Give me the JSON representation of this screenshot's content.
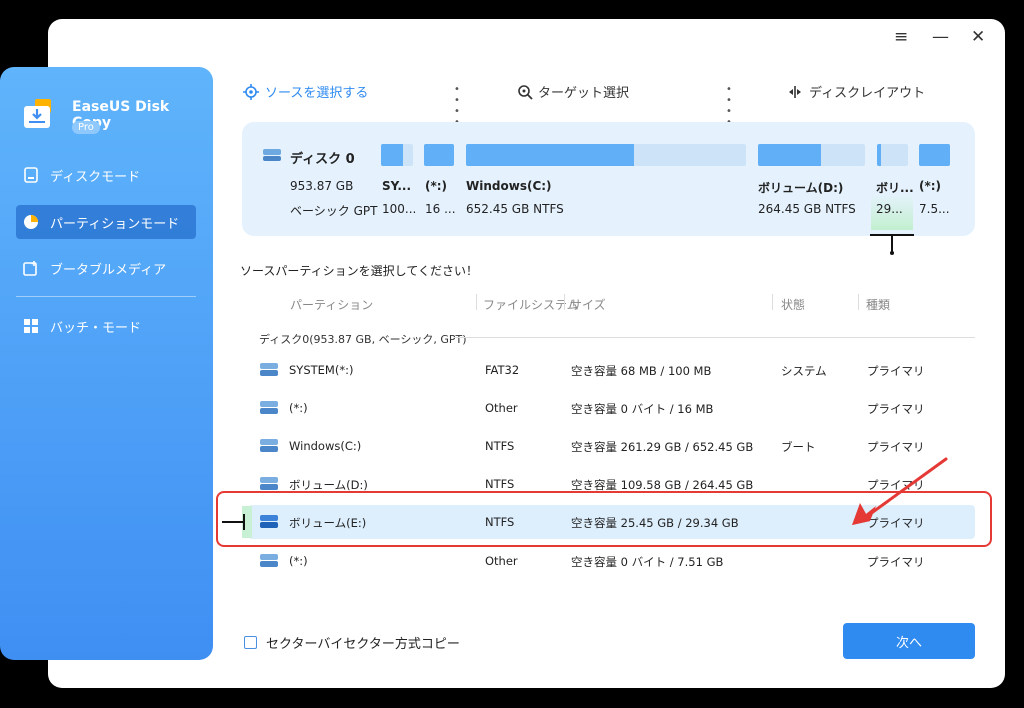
{
  "window_controls": {
    "menu": "≡",
    "minimize": "—",
    "close": "✕"
  },
  "app": {
    "name": "EaseUS Disk Copy",
    "badge": "Pro"
  },
  "sidebar": {
    "items": [
      {
        "label": "ディスクモード",
        "icon": "disk-icon"
      },
      {
        "label": "パーティションモード",
        "icon": "pie-chart-icon",
        "active": true
      },
      {
        "label": "ブータブルメディア",
        "icon": "bootable-media-icon"
      },
      {
        "label": "バッチ・モード",
        "icon": "grid-icon"
      }
    ]
  },
  "steps": {
    "source": "ソースを選択する",
    "target": "ターゲット選択",
    "layout": "ディスクレイアウト",
    "dots": "• • • • ▸"
  },
  "disk_card": {
    "name": "ディスク 0",
    "size": "953.87 GB",
    "type": "ベーシック GPT",
    "partitions": [
      {
        "name": "SY...",
        "size": "100...",
        "fill_fraction": 0.68
      },
      {
        "name": "(*:)",
        "size": "16 ...",
        "fill_fraction": 1.0
      },
      {
        "name": "Windows(C:)",
        "size": "652.45 GB NTFS",
        "fill_fraction": 0.6
      },
      {
        "name": "ボリューム(D:)",
        "size": "264.45 GB NTFS",
        "fill_fraction": 0.59
      },
      {
        "name": "ボリ...",
        "size": "29...",
        "fill_fraction": 0.13
      },
      {
        "name": "(*:)",
        "size": "7.5...",
        "fill_fraction": 1.0
      }
    ]
  },
  "prompt": "ソースパーティションを選択してください！",
  "table": {
    "headers": [
      "パーティション",
      "ファイルシステム",
      "サイズ",
      "状態",
      "種類"
    ],
    "group": "ディスク0(953.87 GB, ベーシック, GPT)",
    "rows": [
      {
        "name": "SYSTEM(*:)",
        "fs": "FAT32",
        "size": "空き容量 68 MB / 100 MB",
        "state": "システム",
        "kind": "プライマリ"
      },
      {
        "name": "(*:)",
        "fs": "Other",
        "size": "空き容量 0 バイト / 16 MB",
        "state": "",
        "kind": "プライマリ"
      },
      {
        "name": "Windows(C:)",
        "fs": "NTFS",
        "size": "空き容量 261.29 GB / 652.45 GB",
        "state": "ブート",
        "kind": "プライマリ"
      },
      {
        "name": "ボリューム(D:)",
        "fs": "NTFS",
        "size": "空き容量 109.58 GB / 264.45 GB",
        "state": "",
        "kind": "プライマリ"
      },
      {
        "name": "ボリューム(E:)",
        "fs": "NTFS",
        "size": "空き容量 25.45 GB / 29.34 GB",
        "state": "",
        "kind": "プライマリ",
        "selected": true
      },
      {
        "name": "(*:)",
        "fs": "Other",
        "size": "空き容量 0 バイト / 7.51 GB",
        "state": "",
        "kind": "プライマリ"
      }
    ]
  },
  "footer": {
    "checkbox_label": "セクターバイセクター方式コピー",
    "next": "次へ"
  },
  "colors": {
    "accent": "#2f8bf0",
    "sidebar_top": "#5fb4fb",
    "highlight": "#e53935"
  }
}
